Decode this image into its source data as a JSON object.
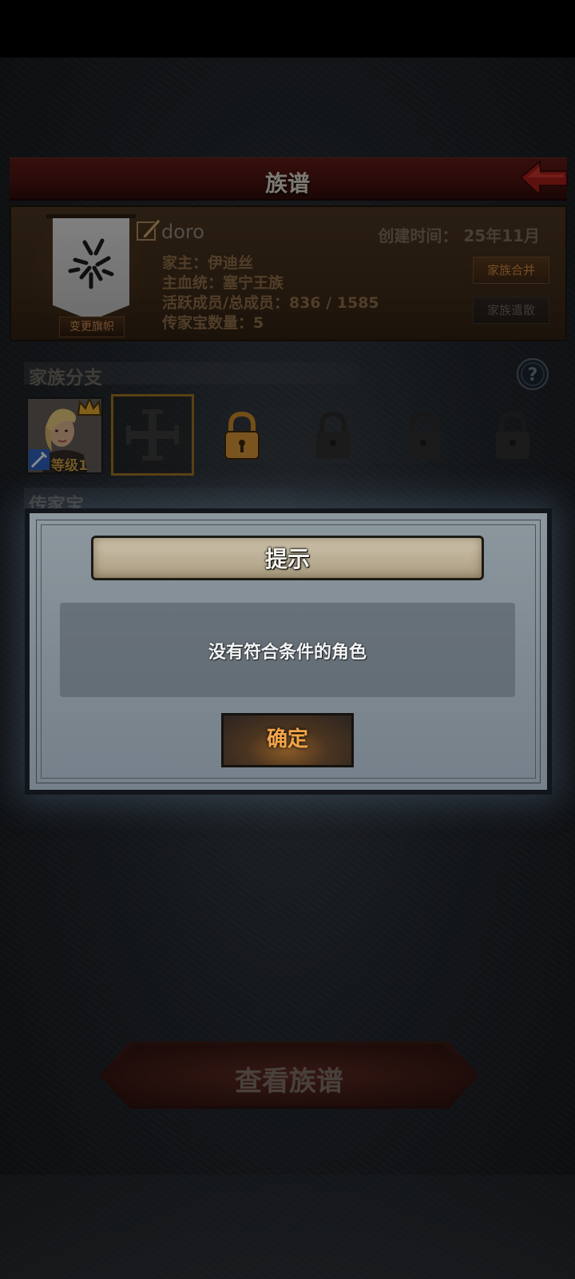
{
  "header": {
    "title": "族谱"
  },
  "family": {
    "name": "doro",
    "created_label": "创建时间：",
    "created_value": "25年11月",
    "head_line": "家主：伊迪丝",
    "bloodline_line": "主血统：塞宁王族",
    "members_line": "活跃成员/总成员：836 / 1585",
    "heirloom_line": "传家宝数量：5",
    "change_flag_label": "变更旗帜",
    "merge_label": "家族合并",
    "disband_label": "家族遣散"
  },
  "branch": {
    "title": "家族分支",
    "member_level": "等级1"
  },
  "heirloom": {
    "title": "传家宝"
  },
  "dialog": {
    "title": "提示",
    "message": "没有符合条件的角色",
    "confirm_label": "确定"
  },
  "footer": {
    "view_tree_label": "查看族谱"
  },
  "colors": {
    "title_bar": "#4a1411",
    "accent_gold": "#c8863e",
    "back_arrow": "#b0221c"
  }
}
